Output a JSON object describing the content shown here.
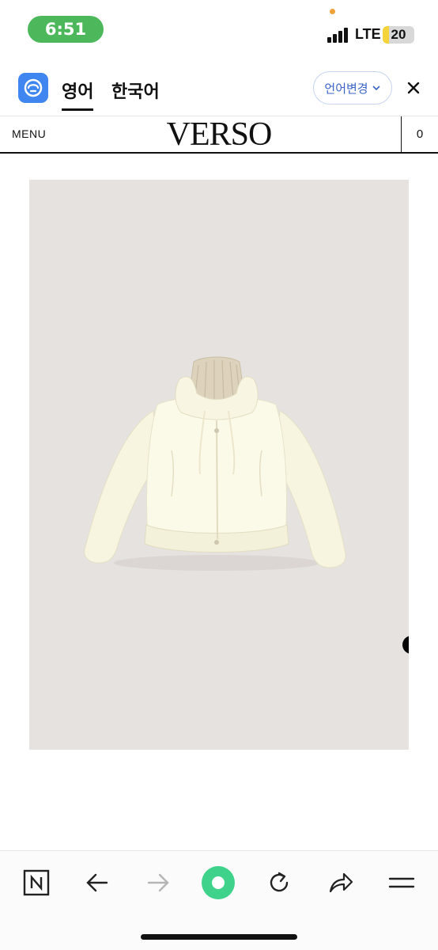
{
  "status_bar": {
    "time": "6:51",
    "network": "LTE",
    "battery_level": "20",
    "battery_fraction": 0.2,
    "signal_bars": 4,
    "colors": {
      "time_pill": "#4cb85b",
      "battery": "#f5d33b",
      "privacy_dot": "#f0a23a"
    }
  },
  "translate_bar": {
    "logo_icon": "translate-app-icon",
    "tabs": [
      {
        "label": "영어",
        "active": true
      },
      {
        "label": "한국어",
        "active": false
      }
    ],
    "change_language_label": "언어변경",
    "close_icon": "close-icon",
    "accent_color": "#3f86f0"
  },
  "site_header": {
    "menu_label": "MENU",
    "logo_text": "VERSO",
    "cart_count": "0"
  },
  "product": {
    "image_alt": "cream puffer jacket with knit collar",
    "background_color": "#e5e2df",
    "carousel_dot_color": "#050505"
  },
  "toolbar": {
    "buttons": [
      {
        "icon": "naver-n-icon"
      },
      {
        "icon": "back-arrow-icon"
      },
      {
        "icon": "forward-arrow-icon",
        "enabled": false
      },
      {
        "icon": "home-green-circle-icon"
      },
      {
        "icon": "reload-icon"
      },
      {
        "icon": "share-icon"
      },
      {
        "icon": "menu-icon"
      }
    ],
    "accent_color": "#3ed28a"
  }
}
